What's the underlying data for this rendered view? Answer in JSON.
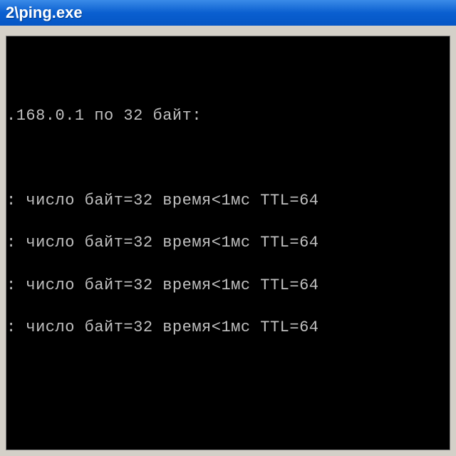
{
  "titlebar": {
    "title": "2\\ping.exe"
  },
  "console": {
    "blank0": "",
    "header": ".168.0.1 по 32 байт:",
    "blank1": "",
    "line1": ": число байт=32 время<1мс TTL=64",
    "line2": ": число байт=32 время<1мс TTL=64",
    "line3": ": число байт=32 время<1мс TTL=64",
    "line4": ": число байт=32 время<1мс TTL=64"
  }
}
